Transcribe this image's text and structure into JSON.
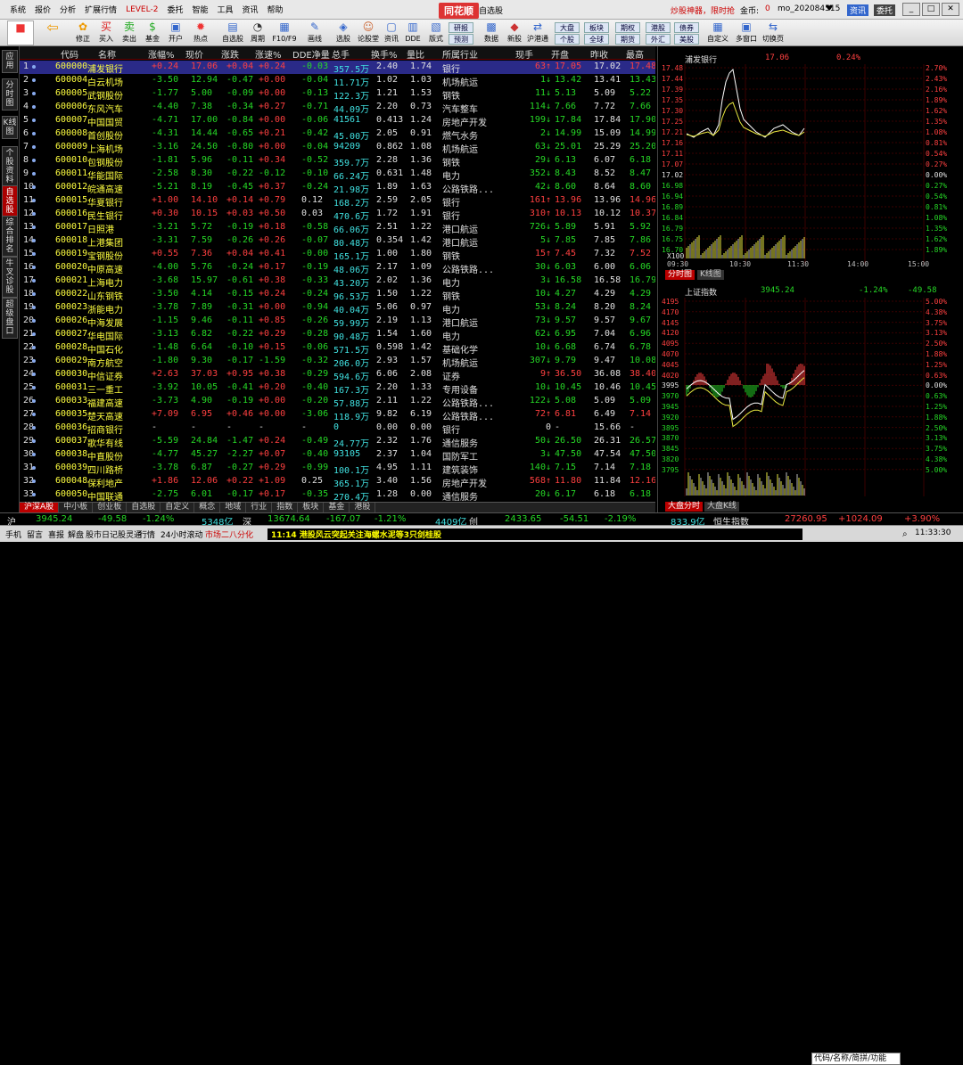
{
  "menu": {
    "items": [
      "系统",
      "报价",
      "分析",
      "扩展行情",
      "LEVEL-2",
      "委托",
      "智能",
      "工具",
      "资讯",
      "帮助"
    ],
    "brand": "同花顺",
    "page": "自选股",
    "promo": "炒股神器，限时抢",
    "gold_label": "金币:",
    "gold_value": "0",
    "user": "mo_202084515",
    "news_btn": "资讯",
    "trade_btn": "委托"
  },
  "toolbar": {
    "items": [
      "应用",
      "修正",
      "买入",
      "卖出",
      "基金",
      "开户",
      "热点",
      "自选股",
      "周期",
      "F10/F9",
      "画线",
      "选股",
      "论股堂",
      "资讯",
      "DDE",
      "版式",
      "",
      "",
      "数据",
      "新股",
      "沪港通",
      "",
      "",
      "",
      "",
      "",
      "自定义",
      "多窗口",
      "切换页"
    ],
    "small": [
      "大盘",
      "板块",
      "期权",
      "港股",
      "债券",
      "个股",
      "全球",
      "期货",
      "外汇",
      "美股",
      "研报",
      "预测"
    ]
  },
  "leftnav": [
    "应用",
    "分时图",
    "K线图",
    "个股资料",
    "自选股",
    "综合排名",
    "牛叉诊股",
    "超级盘口"
  ],
  "headers": [
    "代码",
    "名称",
    "涨幅%",
    "现价",
    "涨跌",
    "涨速%",
    "DDE净量",
    "总手",
    "换手%",
    "量比",
    "所属行业",
    "现手",
    "开盘",
    "昨收",
    "最高"
  ],
  "rows": [
    [
      "1",
      "600000",
      "浦发银行",
      "+0.24",
      "17.06",
      "+0.04",
      "+0.24",
      "-0.03",
      "357.5万",
      "2.40",
      "1.74",
      "银行",
      "63",
      "17.05",
      "17.02",
      "17.48"
    ],
    [
      "2",
      "600004",
      "白云机场",
      "-3.50",
      "12.94",
      "-0.47",
      "+0.00",
      "-0.04",
      "11.71万",
      "1.02",
      "1.03",
      "机场航运",
      "1",
      "13.42",
      "13.41",
      "13.43"
    ],
    [
      "3",
      "600005",
      "武钢股份",
      "-1.77",
      "5.00",
      "-0.09",
      "+0.00",
      "-0.13",
      "122.3万",
      "1.21",
      "1.53",
      "钢铁",
      "11",
      "5.13",
      "5.09",
      "5.22"
    ],
    [
      "4",
      "600006",
      "东风汽车",
      "-4.40",
      "7.38",
      "-0.34",
      "+0.27",
      "-0.71",
      "44.09万",
      "2.20",
      "0.73",
      "汽车整车",
      "114",
      "7.66",
      "7.72",
      "7.66"
    ],
    [
      "5",
      "600007",
      "中国国贸",
      "-4.71",
      "17.00",
      "-0.84",
      "+0.00",
      "-0.06",
      "41561",
      "0.413",
      "1.24",
      "房地产开发",
      "199",
      "17.84",
      "17.84",
      "17.90"
    ],
    [
      "6",
      "600008",
      "首创股份",
      "-4.31",
      "14.44",
      "-0.65",
      "+0.21",
      "-0.42",
      "45.00万",
      "2.05",
      "0.91",
      "燃气水务",
      "2",
      "14.99",
      "15.09",
      "14.99"
    ],
    [
      "7",
      "600009",
      "上海机场",
      "-3.16",
      "24.50",
      "-0.80",
      "+0.00",
      "-0.04",
      "94209",
      "0.862",
      "1.08",
      "机场航运",
      "63",
      "25.01",
      "25.29",
      "25.20"
    ],
    [
      "8",
      "600010",
      "包钢股份",
      "-1.81",
      "5.96",
      "-0.11",
      "+0.34",
      "-0.52",
      "359.7万",
      "2.28",
      "1.36",
      "钢铁",
      "29",
      "6.13",
      "6.07",
      "6.18"
    ],
    [
      "9",
      "600011",
      "华能国际",
      "-2.58",
      "8.30",
      "-0.22",
      "-0.12",
      "-0.10",
      "66.24万",
      "0.631",
      "1.48",
      "电力",
      "352",
      "8.43",
      "8.52",
      "8.47"
    ],
    [
      "10",
      "600012",
      "皖通高速",
      "-5.21",
      "8.19",
      "-0.45",
      "+0.37",
      "-0.24",
      "21.98万",
      "1.89",
      "1.63",
      "公路铁路...",
      "42",
      "8.60",
      "8.64",
      "8.60"
    ],
    [
      "11",
      "600015",
      "华夏银行",
      "+1.00",
      "14.10",
      "+0.14",
      "+0.79",
      "0.12",
      "168.2万",
      "2.59",
      "2.05",
      "银行",
      "161",
      "13.96",
      "13.96",
      "14.96"
    ],
    [
      "12",
      "600016",
      "民生银行",
      "+0.30",
      "10.15",
      "+0.03",
      "+0.50",
      "0.03",
      "470.6万",
      "1.72",
      "1.91",
      "银行",
      "310",
      "10.13",
      "10.12",
      "10.37"
    ],
    [
      "13",
      "600017",
      "日照港",
      "-3.21",
      "5.72",
      "-0.19",
      "+0.18",
      "-0.58",
      "66.06万",
      "2.51",
      "1.22",
      "港口航运",
      "726",
      "5.89",
      "5.91",
      "5.92"
    ],
    [
      "14",
      "600018",
      "上港集团",
      "-3.31",
      "7.59",
      "-0.26",
      "+0.26",
      "-0.07",
      "80.48万",
      "0.354",
      "1.42",
      "港口航运",
      "5",
      "7.85",
      "7.85",
      "7.86"
    ],
    [
      "15",
      "600019",
      "宝钢股份",
      "+0.55",
      "7.36",
      "+0.04",
      "+0.41",
      "-0.00",
      "165.1万",
      "1.00",
      "1.80",
      "钢铁",
      "15",
      "7.45",
      "7.32",
      "7.52"
    ],
    [
      "16",
      "600020",
      "中原高速",
      "-4.00",
      "5.76",
      "-0.24",
      "+0.17",
      "-0.19",
      "48.06万",
      "2.17",
      "1.09",
      "公路铁路...",
      "30",
      "6.03",
      "6.00",
      "6.06"
    ],
    [
      "17",
      "600021",
      "上海电力",
      "-3.68",
      "15.97",
      "-0.61",
      "+0.38",
      "-0.33",
      "43.20万",
      "2.02",
      "1.36",
      "电力",
      "3",
      "16.58",
      "16.58",
      "16.79"
    ],
    [
      "18",
      "600022",
      "山东钢铁",
      "-3.50",
      "4.14",
      "-0.15",
      "+0.24",
      "-0.24",
      "96.53万",
      "1.50",
      "1.22",
      "钢铁",
      "10",
      "4.27",
      "4.29",
      "4.29"
    ],
    [
      "19",
      "600023",
      "浙能电力",
      "-3.78",
      "7.89",
      "-0.31",
      "+0.00",
      "-0.94",
      "40.04万",
      "5.06",
      "0.97",
      "电力",
      "53",
      "8.24",
      "8.20",
      "8.24"
    ],
    [
      "20",
      "600026",
      "中海发展",
      "-1.15",
      "9.46",
      "-0.11",
      "+0.85",
      "-0.26",
      "59.99万",
      "2.19",
      "1.13",
      "港口航运",
      "73",
      "9.57",
      "9.57",
      "9.67"
    ],
    [
      "21",
      "600027",
      "华电国际",
      "-3.13",
      "6.82",
      "-0.22",
      "+0.29",
      "-0.28",
      "90.48万",
      "1.54",
      "1.60",
      "电力",
      "62",
      "6.95",
      "7.04",
      "6.96"
    ],
    [
      "22",
      "600028",
      "中国石化",
      "-1.48",
      "6.64",
      "-0.10",
      "+0.15",
      "-0.06",
      "571.5万",
      "0.598",
      "1.42",
      "基础化学",
      "10",
      "6.68",
      "6.74",
      "6.78"
    ],
    [
      "23",
      "600029",
      "南方航空",
      "-1.80",
      "9.30",
      "-0.17",
      "-1.59",
      "-0.32",
      "206.0万",
      "2.93",
      "1.57",
      "机场航运",
      "307",
      "9.79",
      "9.47",
      "10.08"
    ],
    [
      "24",
      "600030",
      "中信证券",
      "+2.63",
      "37.03",
      "+0.95",
      "+0.38",
      "-0.29",
      "594.6万",
      "6.06",
      "2.08",
      "证券",
      "9",
      "36.50",
      "36.08",
      "38.40"
    ],
    [
      "25",
      "600031",
      "三一重工",
      "-3.92",
      "10.05",
      "-0.41",
      "+0.20",
      "-0.40",
      "167.3万",
      "2.20",
      "1.33",
      "专用设备",
      "10",
      "10.45",
      "10.46",
      "10.45"
    ],
    [
      "26",
      "600033",
      "福建高速",
      "-3.73",
      "4.90",
      "-0.19",
      "+0.00",
      "-0.20",
      "57.88万",
      "2.11",
      "1.22",
      "公路铁路...",
      "122",
      "5.08",
      "5.09",
      "5.09"
    ],
    [
      "27",
      "600035",
      "楚天高速",
      "+7.09",
      "6.95",
      "+0.46",
      "+0.00",
      "-3.06",
      "118.9万",
      "9.82",
      "6.19",
      "公路铁路...",
      "72",
      "6.81",
      "6.49",
      "7.14"
    ],
    [
      "28",
      "600036",
      "招商银行",
      "-",
      "-",
      "-",
      "-",
      "-",
      "0",
      "0.00",
      "0.00",
      "银行",
      "0",
      "-",
      "15.66",
      "-"
    ],
    [
      "29",
      "600037",
      "歌华有线",
      "-5.59",
      "24.84",
      "-1.47",
      "+0.24",
      "-0.49",
      "24.77万",
      "2.32",
      "1.76",
      "通信服务",
      "50",
      "26.50",
      "26.31",
      "26.57"
    ],
    [
      "30",
      "600038",
      "中直股份",
      "-4.77",
      "45.27",
      "-2.27",
      "+0.07",
      "-0.40",
      "93105",
      "2.37",
      "1.04",
      "国防军工",
      "3",
      "47.50",
      "47.54",
      "47.50"
    ],
    [
      "31",
      "600039",
      "四川路桥",
      "-3.78",
      "6.87",
      "-0.27",
      "+0.29",
      "-0.99",
      "100.1万",
      "4.95",
      "1.11",
      "建筑装饰",
      "140",
      "7.15",
      "7.14",
      "7.18"
    ],
    [
      "32",
      "600048",
      "保利地产",
      "+1.86",
      "12.06",
      "+0.22",
      "+1.09",
      "0.25",
      "365.1万",
      "3.40",
      "1.56",
      "房地产开发",
      "568",
      "11.80",
      "11.84",
      "12.16"
    ],
    [
      "33",
      "600050",
      "中国联通",
      "-2.75",
      "6.01",
      "-0.17",
      "+0.17",
      "-0.35",
      "270.4万",
      "1.28",
      "0.00",
      "通信服务",
      "20",
      "6.17",
      "6.18",
      "6.18"
    ]
  ],
  "tabs": [
    "沪深A股",
    "中小板",
    "创业板",
    "自选股",
    "自定义",
    "概念",
    "地域",
    "行业",
    "指数",
    "板块",
    "基金",
    "港股"
  ],
  "rpanel": {
    "stock_name": "浦发银行",
    "stock_price": "17.06",
    "stock_pct": "0.24%",
    "left_scale": [
      "17.48",
      "17.44",
      "17.39",
      "17.35",
      "17.30",
      "17.25",
      "17.21",
      "17.16",
      "17.11",
      "17.07",
      "17.02",
      "16.98",
      "16.94",
      "16.89",
      "16.84",
      "16.79",
      "16.75",
      "16.70"
    ],
    "right_scale": [
      "2.70%",
      "2.43%",
      "2.16%",
      "1.89%",
      "1.62%",
      "1.35%",
      "1.08%",
      "0.81%",
      "0.54%",
      "0.27%",
      "0.00%",
      "0.27%",
      "0.54%",
      "0.81%",
      "1.08%",
      "1.35%",
      "1.62%",
      "1.89%"
    ],
    "x100": "X100",
    "times": [
      "09:30",
      "10:30",
      "11:30",
      "14:00",
      "15:00"
    ],
    "tab_fs": "分时图",
    "tab_k": "K线图",
    "index_name": "上证指数",
    "index_value": "3945.24",
    "index_pct": "-1.24%",
    "index_chg": "-49.58",
    "idx_left": [
      "4195",
      "4170",
      "4145",
      "4120",
      "4095",
      "4070",
      "4045",
      "4020",
      "3995",
      "3970",
      "3945",
      "3920",
      "3895",
      "3870",
      "3845",
      "3820",
      "3795"
    ],
    "idx_right": [
      "5.00%",
      "4.38%",
      "3.75%",
      "3.13%",
      "2.50%",
      "1.88%",
      "1.25%",
      "0.63%",
      "0.00%",
      "0.63%",
      "1.25%",
      "1.88%",
      "2.50%",
      "3.13%",
      "3.75%",
      "4.38%",
      "5.00%"
    ],
    "tab_dp": "大盘分时",
    "tab_dk": "大盘K线"
  },
  "status1": {
    "sh_label": "沪",
    "sh_value": "3945.24",
    "sh_chg": "-49.58",
    "sh_pct": "-1.24%",
    "sh_amt": "5348亿",
    "sz_label": "深",
    "sz_value": "13674.64",
    "sz_chg": "-167.07",
    "sz_pct": "-1.21%",
    "sz_amt": "4409亿",
    "cy_label": "创",
    "cy_value": "2433.65",
    "cy_chg": "-54.51",
    "cy_pct": "-2.19%",
    "hs_amt": "833.9亿",
    "hs_label": "恒生指数",
    "hs_value": "27260.95",
    "hs_chg": "+1024.09",
    "hs_pct": "+3.90%"
  },
  "status2": {
    "items": [
      "手机",
      "留言",
      "喜报",
      "解盘",
      "股市日记",
      "股灵通",
      "行情",
      "24小时滚动"
    ],
    "market": "市场二八分化",
    "news": "11:14 港股风云突起关注海螺水泥等3只剑桂股",
    "search_placeholder": "代码/名称/简拼/功能",
    "time": "11:33:30"
  },
  "colors": {
    "up": "#ff4040",
    "down": "#26d926",
    "select_row": "#2a2a88",
    "brand": "#d33333"
  }
}
